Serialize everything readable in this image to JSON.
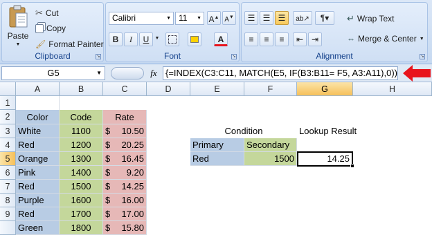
{
  "ribbon": {
    "clipboard": {
      "paste": "Paste",
      "cut": "Cut",
      "copy": "Copy",
      "format_painter": "Format Painter",
      "label": "Clipboard"
    },
    "font": {
      "name": "Calibri",
      "size": "11",
      "bold": "B",
      "italic": "I",
      "underline": "U",
      "font_color": "A",
      "label": "Font"
    },
    "alignment": {
      "wrap_text": "Wrap Text",
      "merge_center": "Merge & Center",
      "label": "Alignment"
    }
  },
  "formula_bar": {
    "name_box": "G5",
    "fx": "fx",
    "formula": "{=INDEX(C3:C11, MATCH(E5, IF(B3:B11= F5, A3:A11),0))}"
  },
  "columns": [
    "A",
    "B",
    "C",
    "D",
    "E",
    "F",
    "G",
    "H"
  ],
  "rows": [
    "1",
    "2",
    "3",
    "4",
    "5",
    "6",
    "7",
    "8",
    "9"
  ],
  "table": {
    "headers": {
      "color": "Color",
      "code": "Code",
      "rate": "Rate"
    },
    "currency": "$",
    "data": [
      {
        "color": "White",
        "code": "1100",
        "rate": "10.50"
      },
      {
        "color": "Red",
        "code": "1200",
        "rate": "20.25"
      },
      {
        "color": "Orange",
        "code": "1300",
        "rate": "16.45"
      },
      {
        "color": "Pink",
        "code": "1400",
        "rate": "9.20"
      },
      {
        "color": "Red",
        "code": "1500",
        "rate": "14.25"
      },
      {
        "color": "Purple",
        "code": "1600",
        "rate": "16.00"
      },
      {
        "color": "Red",
        "code": "1700",
        "rate": "17.00"
      },
      {
        "color": "Green",
        "code": "1800",
        "rate": "15.80"
      }
    ]
  },
  "lookup": {
    "condition": "Condition",
    "result_label": "Lookup Result",
    "primary": "Primary",
    "secondary": "Secondary",
    "primary_value": "Red",
    "secondary_value": "1500",
    "result_value": "14.25"
  },
  "colors": {
    "arrow": "#e8141c",
    "color_col": "#b8cce4",
    "code_col": "#c4d79b",
    "rate_col": "#e6b8b7"
  }
}
